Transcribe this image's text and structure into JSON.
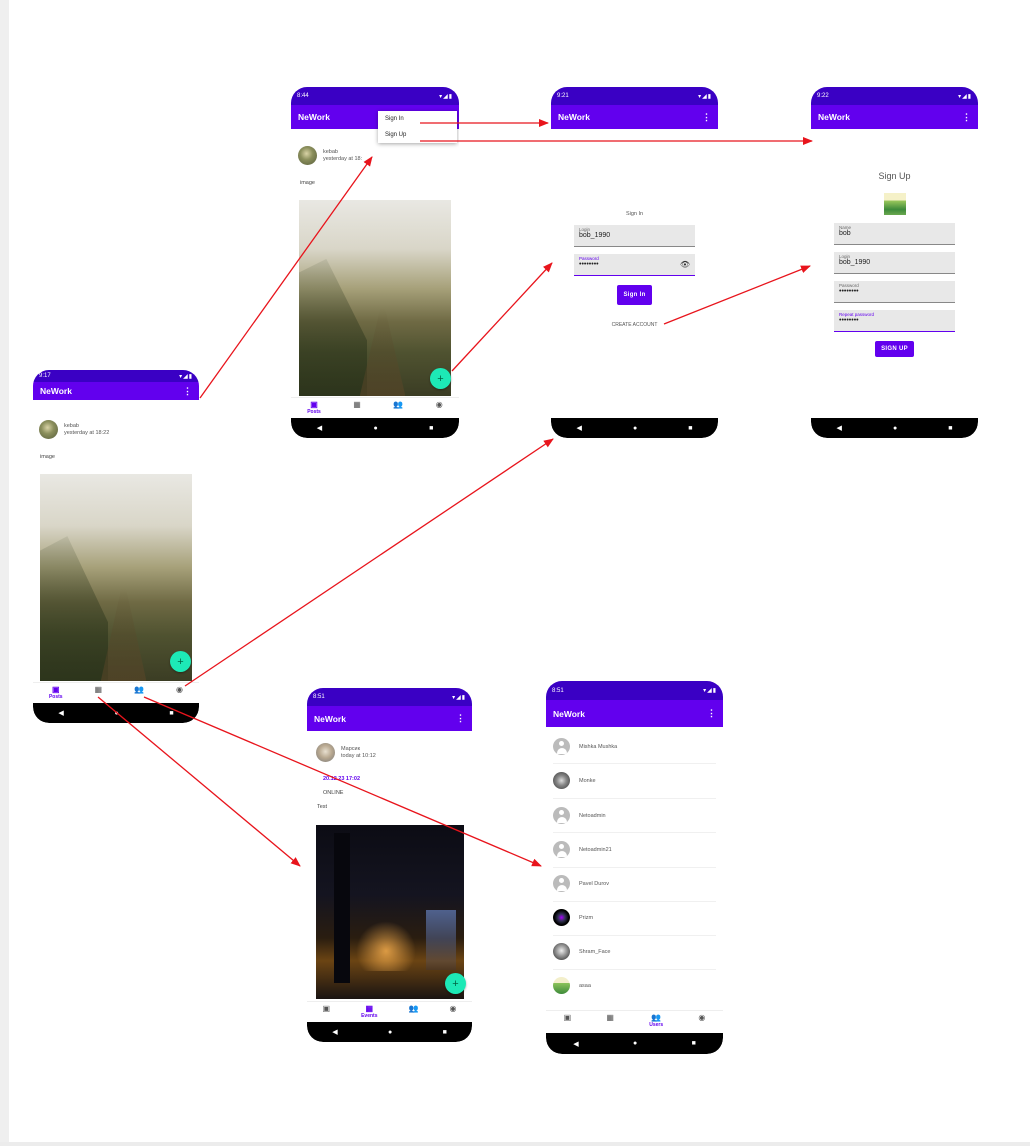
{
  "app": {
    "title": "NeWork",
    "more_icon": "⋮",
    "accent": "#6200ee",
    "status_bar": "#3a00c4",
    "fab_color": "#1de9b6"
  },
  "screens": {
    "main_posts": {
      "time": "9:17",
      "author": "kebab",
      "published": "yesterday at 18:22",
      "content": "image",
      "nav": [
        "Posts"
      ]
    },
    "menu_posts": {
      "time": "8:44",
      "author": "kebab",
      "published": "yesterday at 18:",
      "content": "image",
      "menu": [
        "Sign In",
        "Sign Up"
      ],
      "nav": [
        "Posts"
      ]
    },
    "sign_in": {
      "time": "9:21",
      "heading": "Sign In",
      "login_label": "Login",
      "login_value": "bob_1990",
      "password_label": "Password",
      "password_value": "••••••••",
      "button": "Sign In",
      "create_account": "CREATE ACCOUNT"
    },
    "sign_up": {
      "time": "9:22",
      "heading": "Sign Up",
      "name_label": "Name",
      "name_value": "bob",
      "login_label": "Login",
      "login_value": "bob_1990",
      "password_label": "Password",
      "password_value": "••••••••",
      "repeat_label": "Repeat password",
      "repeat_value": "••••••••",
      "button": "SIGN UP"
    },
    "events": {
      "time": "8:51",
      "author": "Марсик",
      "published": "today at 10:12",
      "datetime": "20.12.23 17:02",
      "type": "ONLINE",
      "content": "Test",
      "nav": [
        "Events"
      ]
    },
    "users": {
      "time": "8:51",
      "users": [
        "Mishka Mushka",
        "Monke",
        "Netoadmin",
        "Netoadmin21",
        "Pavel Durov",
        "Prizm",
        "Shram_Face",
        "asaa"
      ],
      "nav": [
        "Users"
      ]
    }
  }
}
